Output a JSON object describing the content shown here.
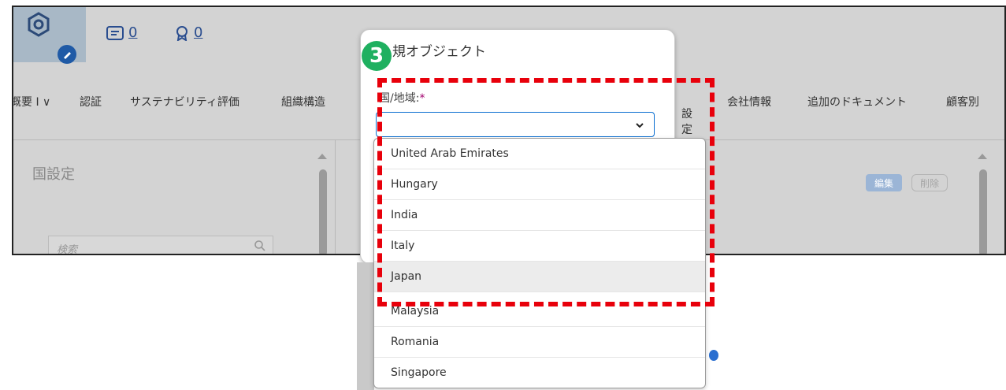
{
  "header": {
    "messages_count": "0",
    "awards_count": "0"
  },
  "nav": {
    "items": [
      "概要 I ∨",
      "認証",
      "サステナビリティ評価",
      "組織構造",
      "設定",
      "会社情報",
      "追加のドキュメント",
      "顧客別"
    ]
  },
  "left_panel": {
    "title": "国設定",
    "search_placeholder": "検索"
  },
  "right_panel": {
    "edit_label": "編集",
    "delete_label": "削除"
  },
  "dialog": {
    "title": "規オブジェクト",
    "field_label": "国/地域:",
    "required_mark": "*",
    "selected_value": ""
  },
  "dropdown": {
    "options": [
      "United Arab Emirates",
      "Hungary",
      "India",
      "Italy",
      "Japan",
      "Malaysia",
      "Romania",
      "Singapore"
    ],
    "highlighted": "Japan"
  },
  "annotation": {
    "step": "3",
    "highlight_color": "#e8000b",
    "badge_color": "#1fb060"
  },
  "colors": {
    "accent": "#0a6ed1",
    "app_background": "#d3d3d3"
  }
}
